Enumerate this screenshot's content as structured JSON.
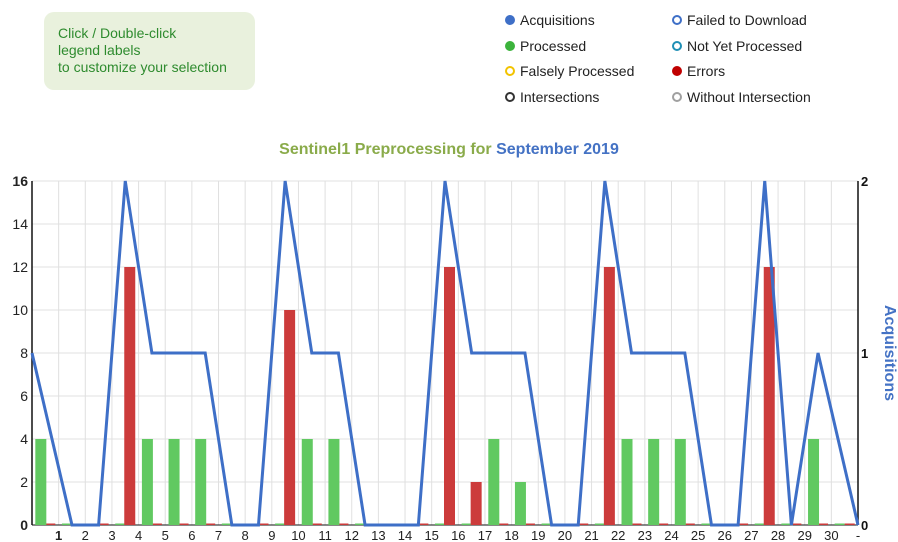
{
  "hint": {
    "line1": "Click / Double-click",
    "line2": "legend labels",
    "line3": "to customize your selection"
  },
  "legend": [
    {
      "label": "Acquisitions",
      "color": "#3e6fc7",
      "style": "filled"
    },
    {
      "label": "Failed to Download",
      "color": "#3e6fc7",
      "style": "ring"
    },
    {
      "label": "Processed",
      "color": "#3cb33c",
      "style": "filled"
    },
    {
      "label": "Not Yet Processed",
      "color": "#1f8fb5",
      "style": "ring"
    },
    {
      "label": "Falsely Processed",
      "color": "#f2c300",
      "style": "ring"
    },
    {
      "label": "Errors",
      "color": "#c00000",
      "style": "filled"
    },
    {
      "label": "Intersections",
      "color": "#333333",
      "style": "ring"
    },
    {
      "label": "Without Intersection",
      "color": "#a0a0a0",
      "style": "ring"
    }
  ],
  "title": {
    "prefix": "Sentinel1 Preprocessing for",
    "month": "September 2019"
  },
  "colors": {
    "processed": "#61c961",
    "errors": "#cc3b3b",
    "acquisitions": "#3e6fc7",
    "grid": "#e0e0e0"
  },
  "chart_data": {
    "type": "bar",
    "categories": [
      "1",
      "2",
      "3",
      "4",
      "5",
      "6",
      "7",
      "8",
      "9",
      "10",
      "11",
      "12",
      "13",
      "14",
      "15",
      "16",
      "17",
      "18",
      "19",
      "20",
      "21",
      "22",
      "23",
      "24",
      "25",
      "26",
      "27",
      "28",
      "29",
      "30",
      "-"
    ],
    "series": [
      {
        "name": "Processed",
        "values": [
          4,
          0,
          0,
          0,
          4,
          4,
          4,
          0,
          0,
          0,
          4,
          4,
          0,
          0,
          0,
          0,
          0,
          4,
          2,
          0,
          0,
          0,
          4,
          4,
          4,
          0,
          0,
          0,
          0,
          4,
          0
        ]
      },
      {
        "name": "Errors",
        "values": [
          0,
          0,
          0,
          12,
          0,
          0,
          0,
          0,
          0,
          10,
          0,
          0,
          0,
          0,
          0,
          12,
          2,
          0,
          0,
          0,
          0,
          12,
          0,
          0,
          0,
          0,
          0,
          12,
          0,
          0,
          0
        ]
      },
      {
        "name": "Acquisitions",
        "axis": "right",
        "type": "line",
        "values": [
          1,
          0,
          0,
          2,
          1,
          1,
          1,
          0,
          0,
          2,
          1,
          1,
          0,
          0,
          0,
          2,
          1,
          1,
          1,
          0,
          0,
          2,
          1,
          1,
          1,
          0,
          0,
          2,
          0,
          1,
          0
        ]
      }
    ],
    "y_left": {
      "min": 0,
      "max": 16,
      "ticks": [
        "0",
        "2",
        "4",
        "6",
        "8",
        "10",
        "12",
        "14",
        "16"
      ]
    },
    "y_right": {
      "min": 0,
      "max": 2,
      "ticks": [
        "0",
        "1",
        "2"
      ],
      "label": "Acquisitions"
    },
    "bold_tick": "1",
    "grid": true
  }
}
